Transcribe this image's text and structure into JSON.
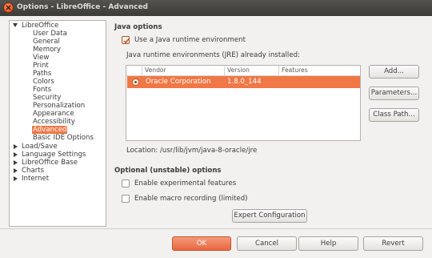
{
  "window": {
    "title": "Options - LibreOffice - Advanced"
  },
  "tree": {
    "root": "LibreOffice",
    "children": [
      "User Data",
      "General",
      "Memory",
      "View",
      "Print",
      "Paths",
      "Colors",
      "Fonts",
      "Security",
      "Personalization",
      "Appearance",
      "Accessibility",
      "Advanced",
      "Basic IDE Options"
    ],
    "selected": "Advanced",
    "collapsed": [
      "Load/Save",
      "Language Settings",
      "LibreOffice Base",
      "Charts",
      "Internet"
    ]
  },
  "java": {
    "section_title": "Java options",
    "use_jre_label": "Use a Java runtime environment",
    "use_jre_checked": true,
    "installed_label": "Java runtime environments (JRE) already installed:",
    "columns": [
      "Vendor",
      "Version",
      "Features"
    ],
    "rows": [
      {
        "vendor": "Oracle Corporation",
        "version": "1.8.0_144",
        "features": ""
      }
    ],
    "location": "Location: /usr/lib/jvm/java-8-oracle/jre",
    "add_label": "Add...",
    "parameters_label": "Parameters...",
    "classpath_label": "Class Path..."
  },
  "optional": {
    "section_title": "Optional (unstable) options",
    "experimental_label": "Enable experimental features",
    "experimental_checked": false,
    "macro_label": "Enable macro recording (limited)",
    "macro_checked": false,
    "expert_label": "Expert Configuration"
  },
  "footer": {
    "ok": "OK",
    "cancel": "Cancel",
    "help": "Help",
    "revert": "Revert"
  },
  "colors": {
    "accent": "#f07746",
    "titlebar": "#3c3b37",
    "window_bg": "#f2f1f0"
  }
}
